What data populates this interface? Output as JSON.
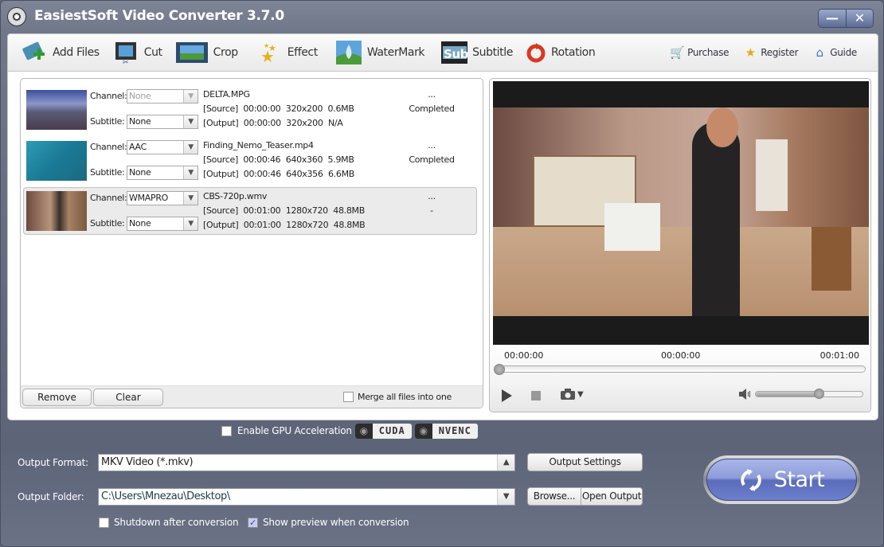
{
  "window": {
    "title": "EasiestSoft Video Converter 3.7.0",
    "minimize_glyph": "—",
    "close_glyph": "✕"
  },
  "toolbar": {
    "items": [
      {
        "label": "Add Files",
        "icon": "add-files-icon"
      },
      {
        "label": "Cut",
        "icon": "cut-icon"
      },
      {
        "label": "Crop",
        "icon": "crop-icon"
      },
      {
        "label": "Effect",
        "icon": "effect-icon"
      },
      {
        "label": "WaterMark",
        "icon": "watermark-icon"
      },
      {
        "label": "Subtitle",
        "icon": "subtitle-icon"
      },
      {
        "label": "Rotation",
        "icon": "rotation-icon"
      }
    ],
    "right_links": [
      {
        "label": "Purchase",
        "icon": "cart-icon"
      },
      {
        "label": "Register",
        "icon": "medal-icon"
      },
      {
        "label": "Guide",
        "icon": "home-icon"
      }
    ]
  },
  "file_list": {
    "channel_label": "Channel:",
    "subtitle_label": "Subtitle:",
    "files": [
      {
        "name": "DELTA.MPG",
        "channel": "None",
        "channel_disabled": true,
        "subtitle": "None",
        "source": "[Source]  00:00:00  320x200  0.6MB",
        "output": "[Output]  00:00:00  320x200  N/A",
        "menu": "...",
        "status": "Completed"
      },
      {
        "name": "Finding_Nemo_Teaser.mp4",
        "channel": "AAC",
        "channel_disabled": false,
        "subtitle": "None",
        "source": "[Source]  00:00:46  640x360  5.9MB",
        "output": "[Output]  00:00:46  640x356  6.6MB",
        "menu": "...",
        "status": "Completed"
      },
      {
        "name": "CBS-720p.wmv",
        "channel": "WMAPRO",
        "channel_disabled": false,
        "subtitle": "None",
        "source": "[Source]  00:01:00  1280x720  48.8MB",
        "output": "[Output]  00:01:00  1280x720  48.8MB",
        "menu": "...",
        "status": "-",
        "selected": true
      }
    ],
    "remove_label": "Remove",
    "clear_label": "Clear",
    "merge_label": "Merge all files into one",
    "merge_checked": false
  },
  "preview": {
    "time_start": "00:00:00",
    "time_current": "00:00:00",
    "time_end": "00:01:00",
    "seek_progress": 0.0,
    "volume_level": 0.6
  },
  "gpu": {
    "label": "Enable GPU Acceleration",
    "checked": false,
    "badges": [
      "CUDA",
      "NVENC"
    ]
  },
  "output": {
    "format_label": "Output Format:",
    "format_value": "MKV Video (*.mkv)",
    "folder_label": "Output Folder:",
    "folder_value": "C:\\Users\\Mnezau\\Desktop\\",
    "settings_button": "Output Settings",
    "browse_button": "Browse...",
    "open_output_button": "Open Output",
    "shutdown_label": "Shutdown after conversion",
    "shutdown_checked": false,
    "show_preview_label": "Show preview when conversion",
    "show_preview_checked": true,
    "start_label": "Start"
  }
}
